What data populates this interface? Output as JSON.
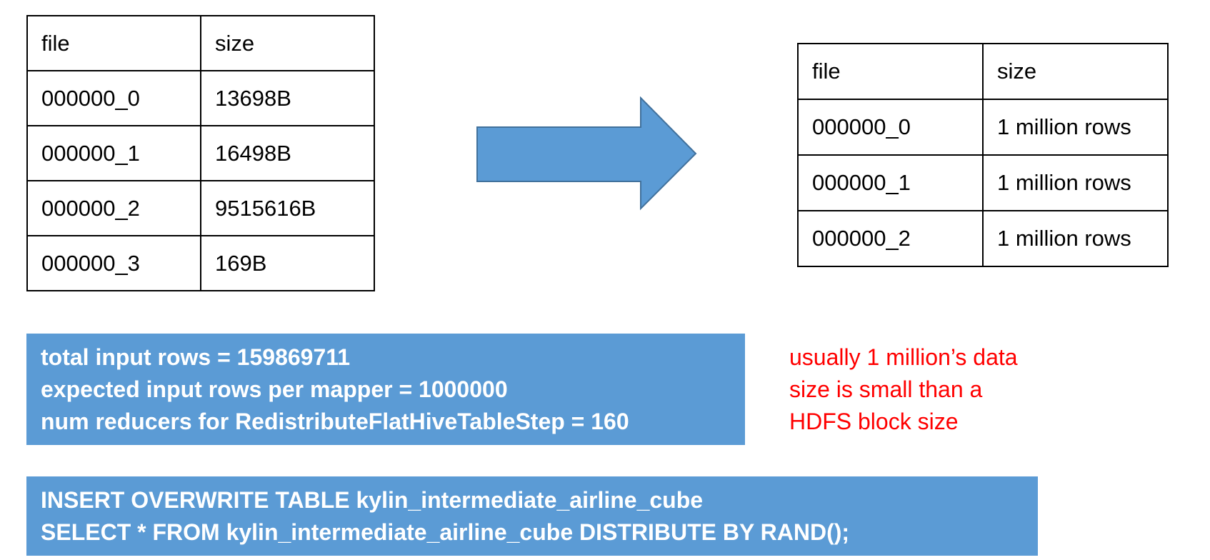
{
  "before_table": {
    "headers": [
      "file",
      "size"
    ],
    "rows": [
      [
        "000000_0",
        "13698B"
      ],
      [
        "000000_1",
        "16498B"
      ],
      [
        "000000_2",
        "9515616B"
      ],
      [
        "000000_3",
        "169B"
      ]
    ]
  },
  "after_table": {
    "headers": [
      "file",
      "size"
    ],
    "rows": [
      [
        "000000_0",
        "1 million rows"
      ],
      [
        "000000_1",
        "1 million rows"
      ],
      [
        "000000_2",
        "1 million rows"
      ]
    ]
  },
  "arrow": {
    "icon": "right-arrow-icon",
    "color": "#5B9BD5"
  },
  "stats_box": {
    "lines": [
      "total input rows = 159869711",
      "expected input rows per mapper = 1000000",
      "num reducers for RedistributeFlatHiveTableStep = 160"
    ]
  },
  "note": {
    "lines": [
      "usually 1 million’s data",
      "size is small than a",
      "HDFS block size"
    ],
    "color": "#FF0000"
  },
  "sql_box": {
    "lines": [
      "INSERT OVERWRITE TABLE kylin_intermediate_airline_cube",
      "SELECT * FROM kylin_intermediate_airline_cube DISTRIBUTE BY RAND();"
    ]
  }
}
